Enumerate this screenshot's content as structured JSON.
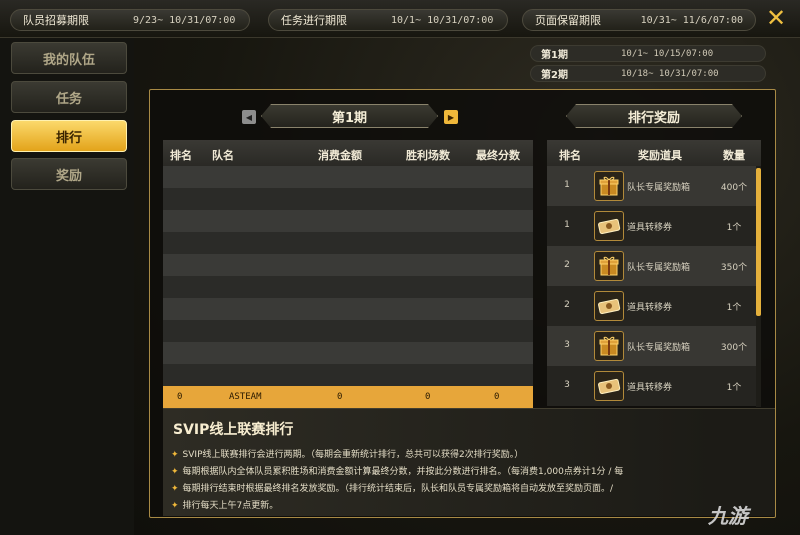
{
  "header": {
    "periods": [
      {
        "label": "队员招募期限",
        "value": "9/23~ 10/31/07:00"
      },
      {
        "label": "任务进行期限",
        "value": "10/1~ 10/31/07:00"
      },
      {
        "label": "页面保留期限",
        "value": "10/31~ 11/6/07:00"
      }
    ],
    "close_label": "✕"
  },
  "sidebar": {
    "items": [
      {
        "label": "我的队伍"
      },
      {
        "label": "任务"
      },
      {
        "label": "排行",
        "active": true
      },
      {
        "label": "奖励"
      }
    ]
  },
  "phase_info": [
    {
      "label": "第1期",
      "value": "10/1~ 10/15/07:00"
    },
    {
      "label": "第2期",
      "value": "10/18~ 10/31/07:00"
    }
  ],
  "ranking": {
    "title": "第1期",
    "prev_label": "◀",
    "next_label": "▶",
    "columns": [
      "排名",
      "队名",
      "消费金额",
      "胜利场数",
      "最终分数"
    ],
    "my_row": [
      "0",
      "ASTEAM",
      "0",
      "0",
      "0"
    ]
  },
  "rewards": {
    "title": "排行奖励",
    "columns": [
      "排名",
      "奖励道具",
      "数量"
    ],
    "rows": [
      {
        "rank": "1",
        "item": "队长专属奖励箱",
        "qty": "400个",
        "icon": "gift-box-icon"
      },
      {
        "rank": "1",
        "item": "道具转移券",
        "qty": "1个",
        "icon": "ticket-icon"
      },
      {
        "rank": "2",
        "item": "队长专属奖励箱",
        "qty": "350个",
        "icon": "gift-box-icon"
      },
      {
        "rank": "2",
        "item": "道具转移券",
        "qty": "1个",
        "icon": "ticket-icon"
      },
      {
        "rank": "3",
        "item": "队长专属奖励箱",
        "qty": "300个",
        "icon": "gift-box-icon"
      },
      {
        "rank": "3",
        "item": "道具转移券",
        "qty": "1个",
        "icon": "ticket-icon"
      }
    ]
  },
  "description": {
    "title": "SVIP线上联赛排行",
    "lines": [
      "SVIP线上联赛排行会进行两期。（每期会重新统计排行，总共可以获得2次排行奖励。）",
      "每期根据队内全体队员累积胜场和消费金额计算最终分数，并按此分数进行排名。（每消费1,000点券计1分 / 每",
      "每期排行结束时根据最终排名发放奖励。（排行统计结束后，队长和队员专属奖励箱将自动发放至奖励页面。/",
      "排行每天上午7点更新。"
    ]
  },
  "watermark": "九游"
}
